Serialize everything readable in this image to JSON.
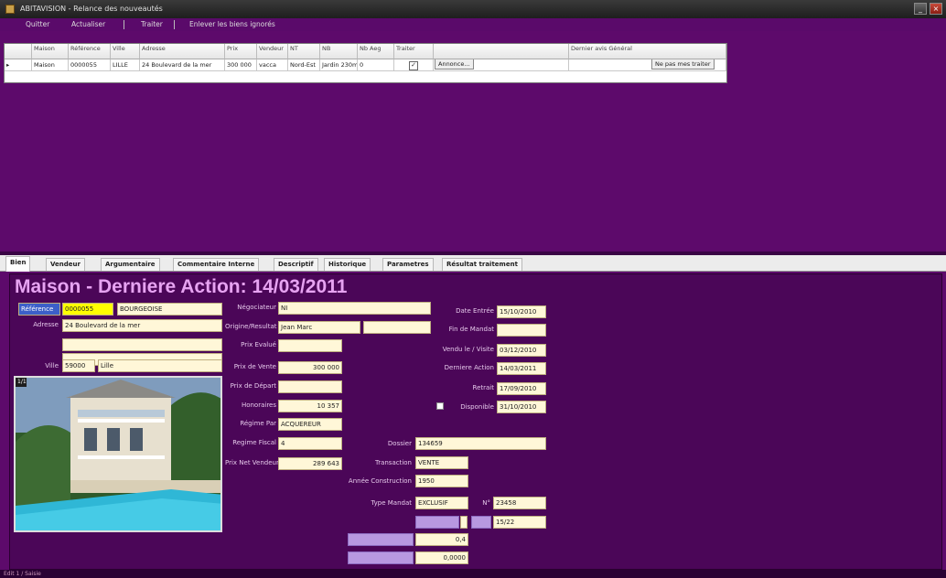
{
  "window": {
    "title": "ABITAVISION - Relance des nouveautés"
  },
  "menu": {
    "quit": "Quitter",
    "refresh": "Actualiser",
    "treat": "Traiter",
    "unmark": "Enlever les biens ignorés"
  },
  "grid": {
    "headers": [
      "Maison",
      "Référence",
      "Ville",
      "Adresse",
      "Prix",
      "Vendeur",
      "NT",
      "NB",
      "Nb Aeg",
      "Traiter",
      "",
      "Dernier avis Général"
    ],
    "row": {
      "type": "Maison",
      "reference": "0000055",
      "city": "LILLE",
      "address": "24 Boulevard de la mer",
      "price": "300 000",
      "seller": "vacca",
      "nt": "Nord-Est",
      "nb": "Jardin 230m²",
      "nbaeg": "0",
      "treat_checked": "✓",
      "btn_label": "Annonce...",
      "action_btn": "Ne pas mes traiter"
    }
  },
  "tabs": [
    "Bien",
    "Vendeur",
    "Argumentaire",
    "Commentaire Interne",
    "Descriptif",
    "Historique",
    "Parametres",
    "Résultat traitement"
  ],
  "detail": {
    "title": "Maison - Derniere Action: 14/03/2011",
    "ref_label": "Référence",
    "ref_value": "0000055",
    "ref_extra": "BOURGEOISE",
    "address_label": "Adresse",
    "address_value": "24 Boulevard de la mer",
    "ville_label": "Ville",
    "cp_value": "59000",
    "city_value": "Lille",
    "photo_caption": "1/1",
    "col2": [
      {
        "label": "Négociateur",
        "value": "NI"
      },
      {
        "label": "Origine/Resultat",
        "value": "Jean Marc"
      },
      {
        "label": "Prix Evalué",
        "value": ""
      },
      {
        "label": "Prix de Vente",
        "value": "300 000"
      },
      {
        "label": "Prix de Départ",
        "value": ""
      },
      {
        "label": "Honoraires",
        "value": "10 357"
      },
      {
        "label": "Régime Par",
        "value": "ACQUEREUR"
      },
      {
        "label": "Regime Fiscal",
        "value": "4"
      },
      {
        "label": "Prix Net Vendeur",
        "value": "289 643"
      }
    ],
    "col3": [
      {
        "label": "Date Entrée",
        "value": "15/10/2010"
      },
      {
        "label": "Fin de Mandat",
        "value": ""
      },
      {
        "label": "Vendu le / Visite",
        "value": "03/12/2010"
      },
      {
        "label": "Derniere Action",
        "value": "14/03/2011"
      },
      {
        "label": "Retrait",
        "value": "17/09/2010"
      },
      {
        "label": "Disponible",
        "value": "31/10/2010"
      }
    ],
    "dossier_label": "Dossier",
    "dossier_value": "134659",
    "transaction_label": "Transaction",
    "transaction_value": "VENTE",
    "year_label": "Année Construction",
    "year_value": "1950",
    "mandat_label": "Type Mandat",
    "mandat_value": "EXCLUSIF",
    "num_label": "N°",
    "num_value": "23458",
    "extra_value": "15/22",
    "rate_value": "0,4",
    "amount_value": "0,0000"
  },
  "status": {
    "left": "Edit 1 / Saisie"
  }
}
